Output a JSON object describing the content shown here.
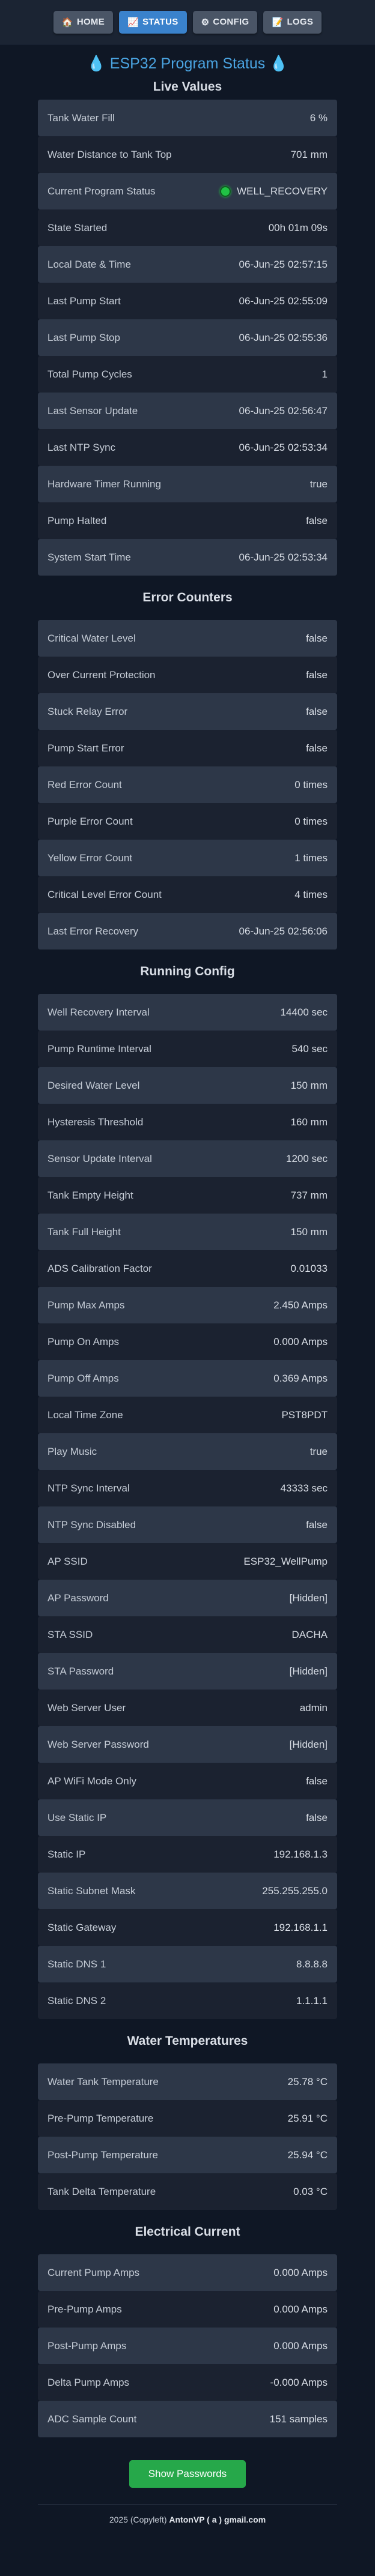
{
  "nav": {
    "home": {
      "label": "HOME",
      "icon": "house-icon"
    },
    "status": {
      "label": "STATUS",
      "icon": "chart-icon"
    },
    "config": {
      "label": "CONFIG",
      "icon": "gear-icon"
    },
    "logs": {
      "label": "LOGS",
      "icon": "memo-icon"
    }
  },
  "title": "ESP32 Program Status",
  "sections": [
    {
      "title": "Live Values",
      "rows": [
        {
          "label": "Tank Water Fill",
          "value": "6 %"
        },
        {
          "label": "Water Distance to Tank Top",
          "value": "701 mm"
        },
        {
          "label": "Current Program Status",
          "value": "WELL_RECOVERY",
          "indicator": "green"
        },
        {
          "label": "State Started",
          "value": "00h 01m 09s"
        },
        {
          "label": "Local Date & Time",
          "value": "06-Jun-25 02:57:15"
        },
        {
          "label": "Last Pump Start",
          "value": "06-Jun-25 02:55:09"
        },
        {
          "label": "Last Pump Stop",
          "value": "06-Jun-25 02:55:36"
        },
        {
          "label": "Total Pump Cycles",
          "value": "1"
        },
        {
          "label": "Last Sensor Update",
          "value": "06-Jun-25 02:56:47"
        },
        {
          "label": "Last NTP Sync",
          "value": "06-Jun-25 02:53:34"
        },
        {
          "label": "Hardware Timer Running",
          "value": "true"
        },
        {
          "label": "Pump Halted",
          "value": "false"
        },
        {
          "label": "System Start Time",
          "value": "06-Jun-25 02:53:34"
        }
      ]
    },
    {
      "title": "Error Counters",
      "rows": [
        {
          "label": "Critical Water Level",
          "value": "false"
        },
        {
          "label": "Over Current Protection",
          "value": "false"
        },
        {
          "label": "Stuck Relay Error",
          "value": "false"
        },
        {
          "label": "Pump Start Error",
          "value": "false"
        },
        {
          "label": "Red Error Count",
          "value": "0 times"
        },
        {
          "label": "Purple Error Count",
          "value": "0 times"
        },
        {
          "label": "Yellow Error Count",
          "value": "1 times"
        },
        {
          "label": "Critical Level Error Count",
          "value": "4 times"
        },
        {
          "label": "Last Error Recovery",
          "value": "06-Jun-25 02:56:06"
        }
      ]
    },
    {
      "title": "Running Config",
      "rows": [
        {
          "label": "Well Recovery Interval",
          "value": "14400 sec"
        },
        {
          "label": "Pump Runtime Interval",
          "value": "540 sec"
        },
        {
          "label": "Desired Water Level",
          "value": "150 mm"
        },
        {
          "label": "Hysteresis Threshold",
          "value": "160 mm"
        },
        {
          "label": "Sensor Update Interval",
          "value": "1200 sec"
        },
        {
          "label": "Tank Empty Height",
          "value": "737 mm"
        },
        {
          "label": "Tank Full Height",
          "value": "150 mm"
        },
        {
          "label": "ADS Calibration Factor",
          "value": "0.01033"
        },
        {
          "label": "Pump Max Amps",
          "value": "2.450 Amps"
        },
        {
          "label": "Pump On Amps",
          "value": "0.000 Amps"
        },
        {
          "label": "Pump Off Amps",
          "value": "0.369 Amps"
        },
        {
          "label": "Local Time Zone",
          "value": "PST8PDT"
        },
        {
          "label": "Play Music",
          "value": "true"
        },
        {
          "label": "NTP Sync Interval",
          "value": "43333 sec"
        },
        {
          "label": "NTP Sync Disabled",
          "value": "false"
        },
        {
          "label": "AP SSID",
          "value": "ESP32_WellPump"
        },
        {
          "label": "AP Password",
          "value": "[Hidden]"
        },
        {
          "label": "STA SSID",
          "value": "DACHA"
        },
        {
          "label": "STA Password",
          "value": "[Hidden]"
        },
        {
          "label": "Web Server User",
          "value": "admin"
        },
        {
          "label": "Web Server Password",
          "value": "[Hidden]"
        },
        {
          "label": "AP WiFi Mode Only",
          "value": "false"
        },
        {
          "label": "Use Static IP",
          "value": "false"
        },
        {
          "label": "Static IP",
          "value": "192.168.1.3"
        },
        {
          "label": "Static Subnet Mask",
          "value": "255.255.255.0"
        },
        {
          "label": "Static Gateway",
          "value": "192.168.1.1"
        },
        {
          "label": "Static DNS 1",
          "value": "8.8.8.8"
        },
        {
          "label": "Static DNS 2",
          "value": "1.1.1.1"
        }
      ]
    },
    {
      "title": "Water Temperatures",
      "rows": [
        {
          "label": "Water Tank Temperature",
          "value": "25.78 °C"
        },
        {
          "label": "Pre-Pump Temperature",
          "value": "25.91 °C"
        },
        {
          "label": "Post-Pump Temperature",
          "value": "25.94 °C"
        },
        {
          "label": "Tank Delta Temperature",
          "value": "0.03 °C"
        }
      ]
    },
    {
      "title": "Electrical Current",
      "rows": [
        {
          "label": "Current Pump Amps",
          "value": "0.000 Amps"
        },
        {
          "label": "Pre-Pump Amps",
          "value": "0.000 Amps"
        },
        {
          "label": "Post-Pump Amps",
          "value": "0.000 Amps"
        },
        {
          "label": "Delta Pump Amps",
          "value": "-0.000 Amps"
        },
        {
          "label": "ADC Sample Count",
          "value": "151 samples"
        }
      ]
    }
  ],
  "show_passwords_label": "Show Passwords",
  "footer": {
    "prefix": "2025 (Copyleft) ",
    "author": "AntonVP ( a ) gmail.com"
  },
  "colors": {
    "accent": "#3a82cc",
    "title": "#4aa3e0",
    "status_green": "#21c245",
    "button_green": "#26a84a"
  }
}
